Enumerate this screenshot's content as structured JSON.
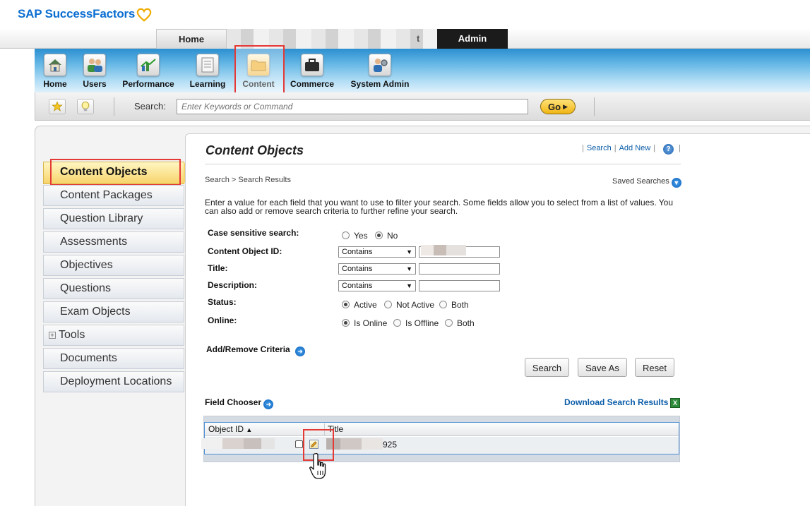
{
  "brand": {
    "name": "SAP SuccessFactors"
  },
  "top_tabs": [
    {
      "label": "Home"
    },
    {
      "label": "t"
    },
    {
      "label": "Admin"
    }
  ],
  "modules": [
    {
      "label": "Home",
      "icon": "house-icon"
    },
    {
      "label": "Users",
      "icon": "users-icon"
    },
    {
      "label": "Performance",
      "icon": "chart-icon"
    },
    {
      "label": "Learning",
      "icon": "notepad-icon"
    },
    {
      "label": "Content",
      "icon": "folder-icon",
      "active": true
    },
    {
      "label": "Commerce",
      "icon": "briefcase-icon"
    },
    {
      "label": "System Admin",
      "icon": "admin-gear-icon"
    }
  ],
  "search_bar": {
    "label": "Search:",
    "placeholder": "Enter Keywords or Command",
    "go_label": "Go"
  },
  "side_menu": {
    "active": "Content Objects",
    "items": [
      {
        "label": "Content Packages"
      },
      {
        "label": "Question Library"
      },
      {
        "label": "Assessments"
      },
      {
        "label": "Objectives"
      },
      {
        "label": "Questions"
      },
      {
        "label": "Exam Objects"
      },
      {
        "label": "Tools",
        "expandable": true
      },
      {
        "label": "Documents"
      },
      {
        "label": "Deployment Locations"
      }
    ]
  },
  "content": {
    "title": "Content Objects",
    "links": {
      "search": "Search",
      "add_new": "Add New"
    },
    "help_icon": "?",
    "breadcrumb": "Search > Search Results",
    "saved_searches": "Saved Searches",
    "instructions": "Enter a value for each field that you want to use to filter your search. Some fields allow you to select from a list of values. You can also add or remove search criteria to further refine your search."
  },
  "criteria": {
    "case_sensitive": {
      "label": "Case sensitive search:",
      "options": [
        "Yes",
        "No"
      ],
      "selected": "No"
    },
    "content_object_id": {
      "label": "Content Object ID:",
      "operator": "Contains",
      "value": ""
    },
    "title": {
      "label": "Title:",
      "operator": "Contains",
      "value": ""
    },
    "description": {
      "label": "Description:",
      "operator": "Contains",
      "value": ""
    },
    "status": {
      "label": "Status:",
      "options": [
        "Active",
        "Not Active",
        "Both"
      ],
      "selected": "Active"
    },
    "online": {
      "label": "Online:",
      "options": [
        "Is Online",
        "Is Offline",
        "Both"
      ],
      "selected": "Is Online"
    },
    "add_remove_label": "Add/Remove Criteria"
  },
  "buttons": {
    "search": "Search",
    "save_as": "Save As",
    "reset": "Reset"
  },
  "results": {
    "field_chooser": "Field Chooser",
    "download": "Download Search Results",
    "columns": [
      "Object ID",
      "Title"
    ],
    "sort_indicator": "▲",
    "rows": [
      {
        "title_tail": "925"
      }
    ]
  },
  "colors": {
    "brand_blue": "#0a6ed1",
    "highlight_red": "#e53935",
    "active_yellow": "#f7d46b",
    "link_blue": "#0a5ca8"
  }
}
